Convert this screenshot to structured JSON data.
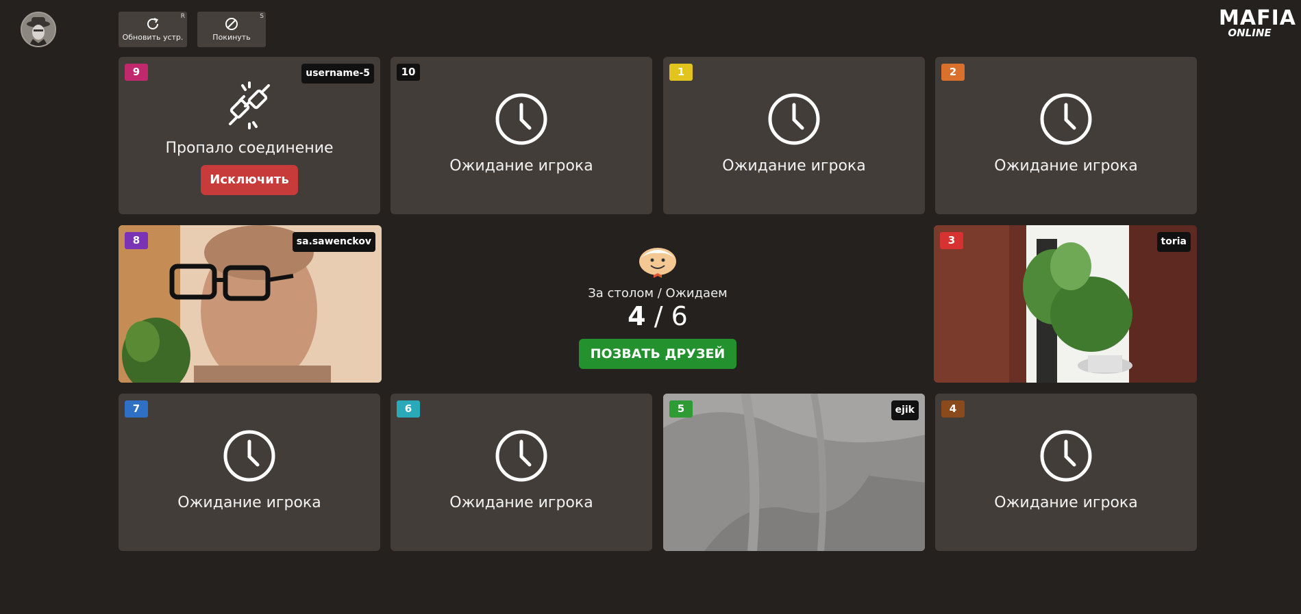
{
  "toolbar": {
    "refresh": {
      "label": "Обновить устр.",
      "hotkey": "R"
    },
    "leave": {
      "label": "Покинуть",
      "hotkey": "S"
    }
  },
  "brand": {
    "line1": "MAFIA",
    "line2": "ONLINE"
  },
  "colors": {
    "background": "#24211e",
    "tile": "#433d39",
    "kick": "#c83b3b",
    "invite": "#22912e"
  },
  "seats": [
    {
      "number": "9",
      "badge_color": "#c2286e",
      "status": "disconnected",
      "name": "username-5",
      "status_text": "Пропало соединение",
      "action": "Исключить"
    },
    {
      "number": "10",
      "badge_color": "#111111",
      "status": "waiting",
      "status_text": "Ожидание игрока"
    },
    {
      "number": "1",
      "badge_color": "#e1c51e",
      "status": "waiting",
      "status_text": "Ожидание игрока"
    },
    {
      "number": "2",
      "badge_color": "#d9702c",
      "status": "waiting",
      "status_text": "Ожидание игрока"
    },
    {
      "number": "8",
      "badge_color": "#7b33b5",
      "status": "video",
      "name": "sa.sawenckov"
    },
    {
      "number": "3",
      "badge_color": "#d63232",
      "status": "video",
      "name": "toria"
    },
    {
      "number": "7",
      "badge_color": "#2f6fc4",
      "status": "waiting",
      "status_text": "Ожидание игрока"
    },
    {
      "number": "6",
      "badge_color": "#2aa9b8",
      "status": "waiting",
      "status_text": "Ожидание игрока"
    },
    {
      "number": "5",
      "badge_color": "#2e9b35",
      "status": "video",
      "name": "ejik"
    },
    {
      "number": "4",
      "badge_color": "#8a4a1c",
      "status": "waiting",
      "status_text": "Ожидание игрока"
    }
  ],
  "lobby": {
    "label": "За столом / Ожидаем",
    "seated": "4",
    "separator": "/",
    "needed": "6",
    "invite_button": "ПОЗВАТЬ ДРУЗЕЙ"
  }
}
